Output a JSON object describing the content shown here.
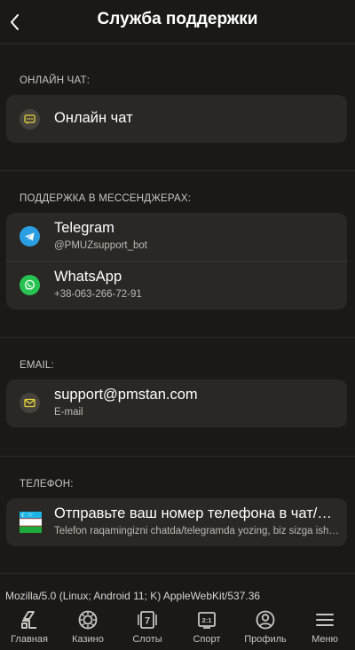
{
  "header": {
    "title": "Служба поддержки",
    "back_icon": "chevron-left-icon"
  },
  "online_chat": {
    "section_label": "ОНЛАЙН ЧАТ:",
    "item": {
      "title": "Онлайн чат",
      "icon": "chat-bubble-icon"
    }
  },
  "messengers": {
    "section_label": "ПОДДЕРЖКА В МЕССЕНДЖЕРАХ:",
    "items": [
      {
        "title": "Telegram",
        "subtitle": "@PMUZsupport_bot",
        "icon": "telegram-icon",
        "color": "#2a9ee1"
      },
      {
        "title": "WhatsApp",
        "subtitle": "+38-063-266-72-91",
        "icon": "whatsapp-icon",
        "color": "#27c251"
      }
    ]
  },
  "email": {
    "section_label": "EMAIL:",
    "item": {
      "title": "support@pmstan.com",
      "subtitle": "E-mail",
      "icon": "envelope-icon"
    }
  },
  "phone": {
    "section_label": "ТЕЛЕФОН:",
    "item": {
      "title": "Отправьте ваш номер телефона в чат/телеграм",
      "subtitle": "Telefon raqamingizni chatda/telegramda yozing, biz sizga ish vaqtida qo'ng'iroq qilamiz",
      "icon": "uzbekistan-flag-icon"
    }
  },
  "user_agent": "Mozilla/5.0 (Linux; Android 11; K) AppleWebKit/537.36",
  "tabbar": {
    "items": [
      {
        "label": "Главная",
        "icon": "home-icon"
      },
      {
        "label": "Казино",
        "icon": "casino-chip-icon"
      },
      {
        "label": "Слоты",
        "icon": "slots-icon"
      },
      {
        "label": "Спорт",
        "icon": "score-icon"
      },
      {
        "label": "Профиль",
        "icon": "profile-icon"
      },
      {
        "label": "Меню",
        "icon": "menu-icon"
      }
    ],
    "slots_glyph": "7",
    "sport_glyph": "2:1"
  },
  "colors": {
    "background": "#1a1918",
    "card": "#2a2825",
    "accent_yellow": "#e6d23a"
  }
}
